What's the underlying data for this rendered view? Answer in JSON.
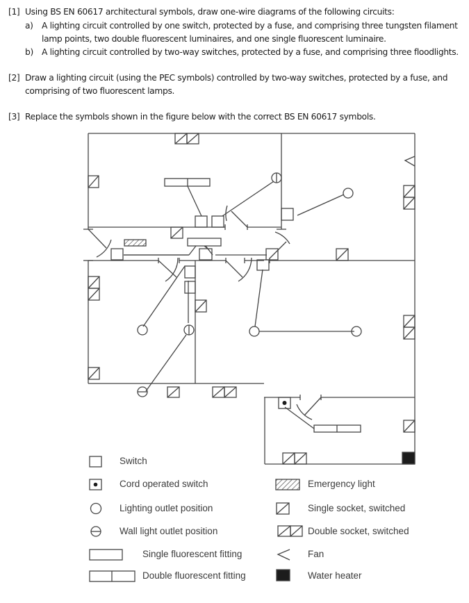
{
  "questions": {
    "q1": {
      "number": "[1]",
      "text": "Using BS EN 60617 architectural symbols, draw one-wire diagrams of the following circuits:",
      "parts": [
        {
          "label": "a)",
          "line1": "A lighting circuit controlled by one switch, protected  by a fuse, and comprising three tungsten filament",
          "line2": "lamp points, two double fluorescent luminaires, and one single fluorescent luminaire."
        },
        {
          "label": "b)",
          "line1": "A lighting circuit controlled by two-way switches,  protected by a fuse, and comprising three floodlights."
        }
      ]
    },
    "q2": {
      "number": "[2]",
      "line1": "Draw a lighting circuit (using the PEC symbols) controlled by two-way switches,  protected by a fuse, and",
      "line2": "comprising of two fluorescent lamps."
    },
    "q3": {
      "number": "[3]",
      "text": "Replace the symbols shown in the figure below with the correct BS EN 60617 symbols."
    }
  },
  "legend": {
    "left": [
      {
        "icon": "switch-icon",
        "label": "Switch"
      },
      {
        "icon": "cord-operated-switch-icon",
        "label": "Cord operated switch"
      },
      {
        "icon": "lighting-outlet-icon",
        "label": "Lighting outlet position"
      },
      {
        "icon": "wall-light-outlet-icon",
        "label": "Wall light outlet position"
      },
      {
        "icon": "single-fluorescent-icon",
        "label": "Single fluorescent fitting"
      },
      {
        "icon": "double-fluorescent-icon",
        "label": "Double fluorescent fitting"
      }
    ],
    "right": [
      {
        "icon": "emergency-light-icon",
        "label": "Emergency light"
      },
      {
        "icon": "single-socket-icon",
        "label": "Single socket, switched"
      },
      {
        "icon": "double-socket-icon",
        "label": "Double socket, switched"
      },
      {
        "icon": "fan-icon",
        "label": "Fan"
      },
      {
        "icon": "water-heater-icon",
        "label": "Water heater"
      }
    ]
  },
  "colors": {
    "line": "#444444",
    "fill_dark": "#1c1c1c",
    "text": "#1a1a1a"
  }
}
